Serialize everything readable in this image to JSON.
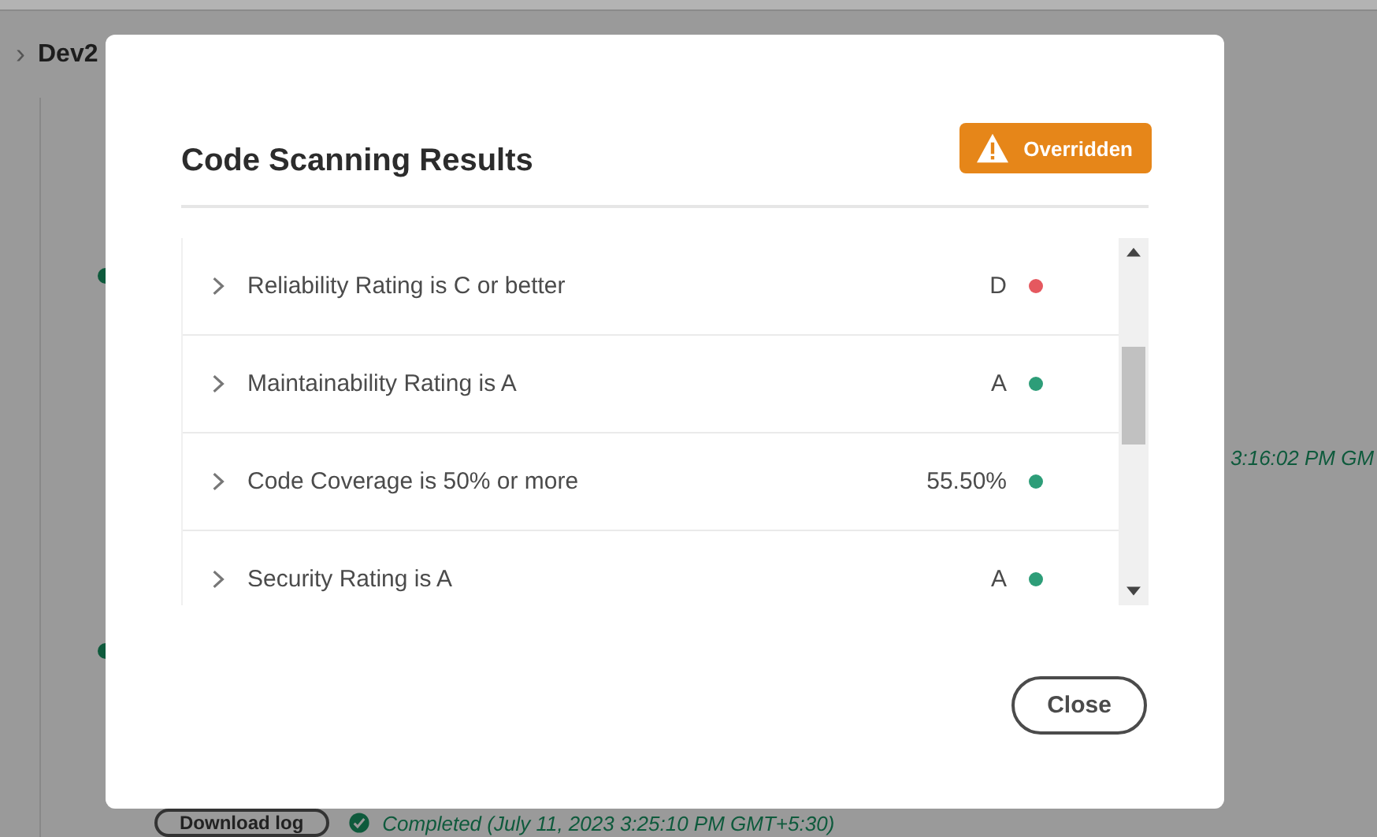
{
  "breadcrumb": {
    "separator": "›",
    "current": "Dev2"
  },
  "background": {
    "timestamp": "3:16:02 PM GM",
    "download_button": "Download log",
    "status": "Completed (July 11, 2023 3:25:10 PM GMT+5:30)"
  },
  "dialog": {
    "title": "Code Scanning Results",
    "badge": {
      "label": "Overridden"
    },
    "results": [
      {
        "label": "Reliability Rating is C or better",
        "value": "D",
        "color": "#e5585f"
      },
      {
        "label": "Maintainability Rating is A",
        "value": "A",
        "color": "#2d9d78"
      },
      {
        "label": "Code Coverage is 50% or more",
        "value": "55.50%",
        "color": "#2d9d78"
      },
      {
        "label": "Security Rating is A",
        "value": "A",
        "color": "#2d9d78"
      }
    ],
    "close_button": "Close"
  }
}
